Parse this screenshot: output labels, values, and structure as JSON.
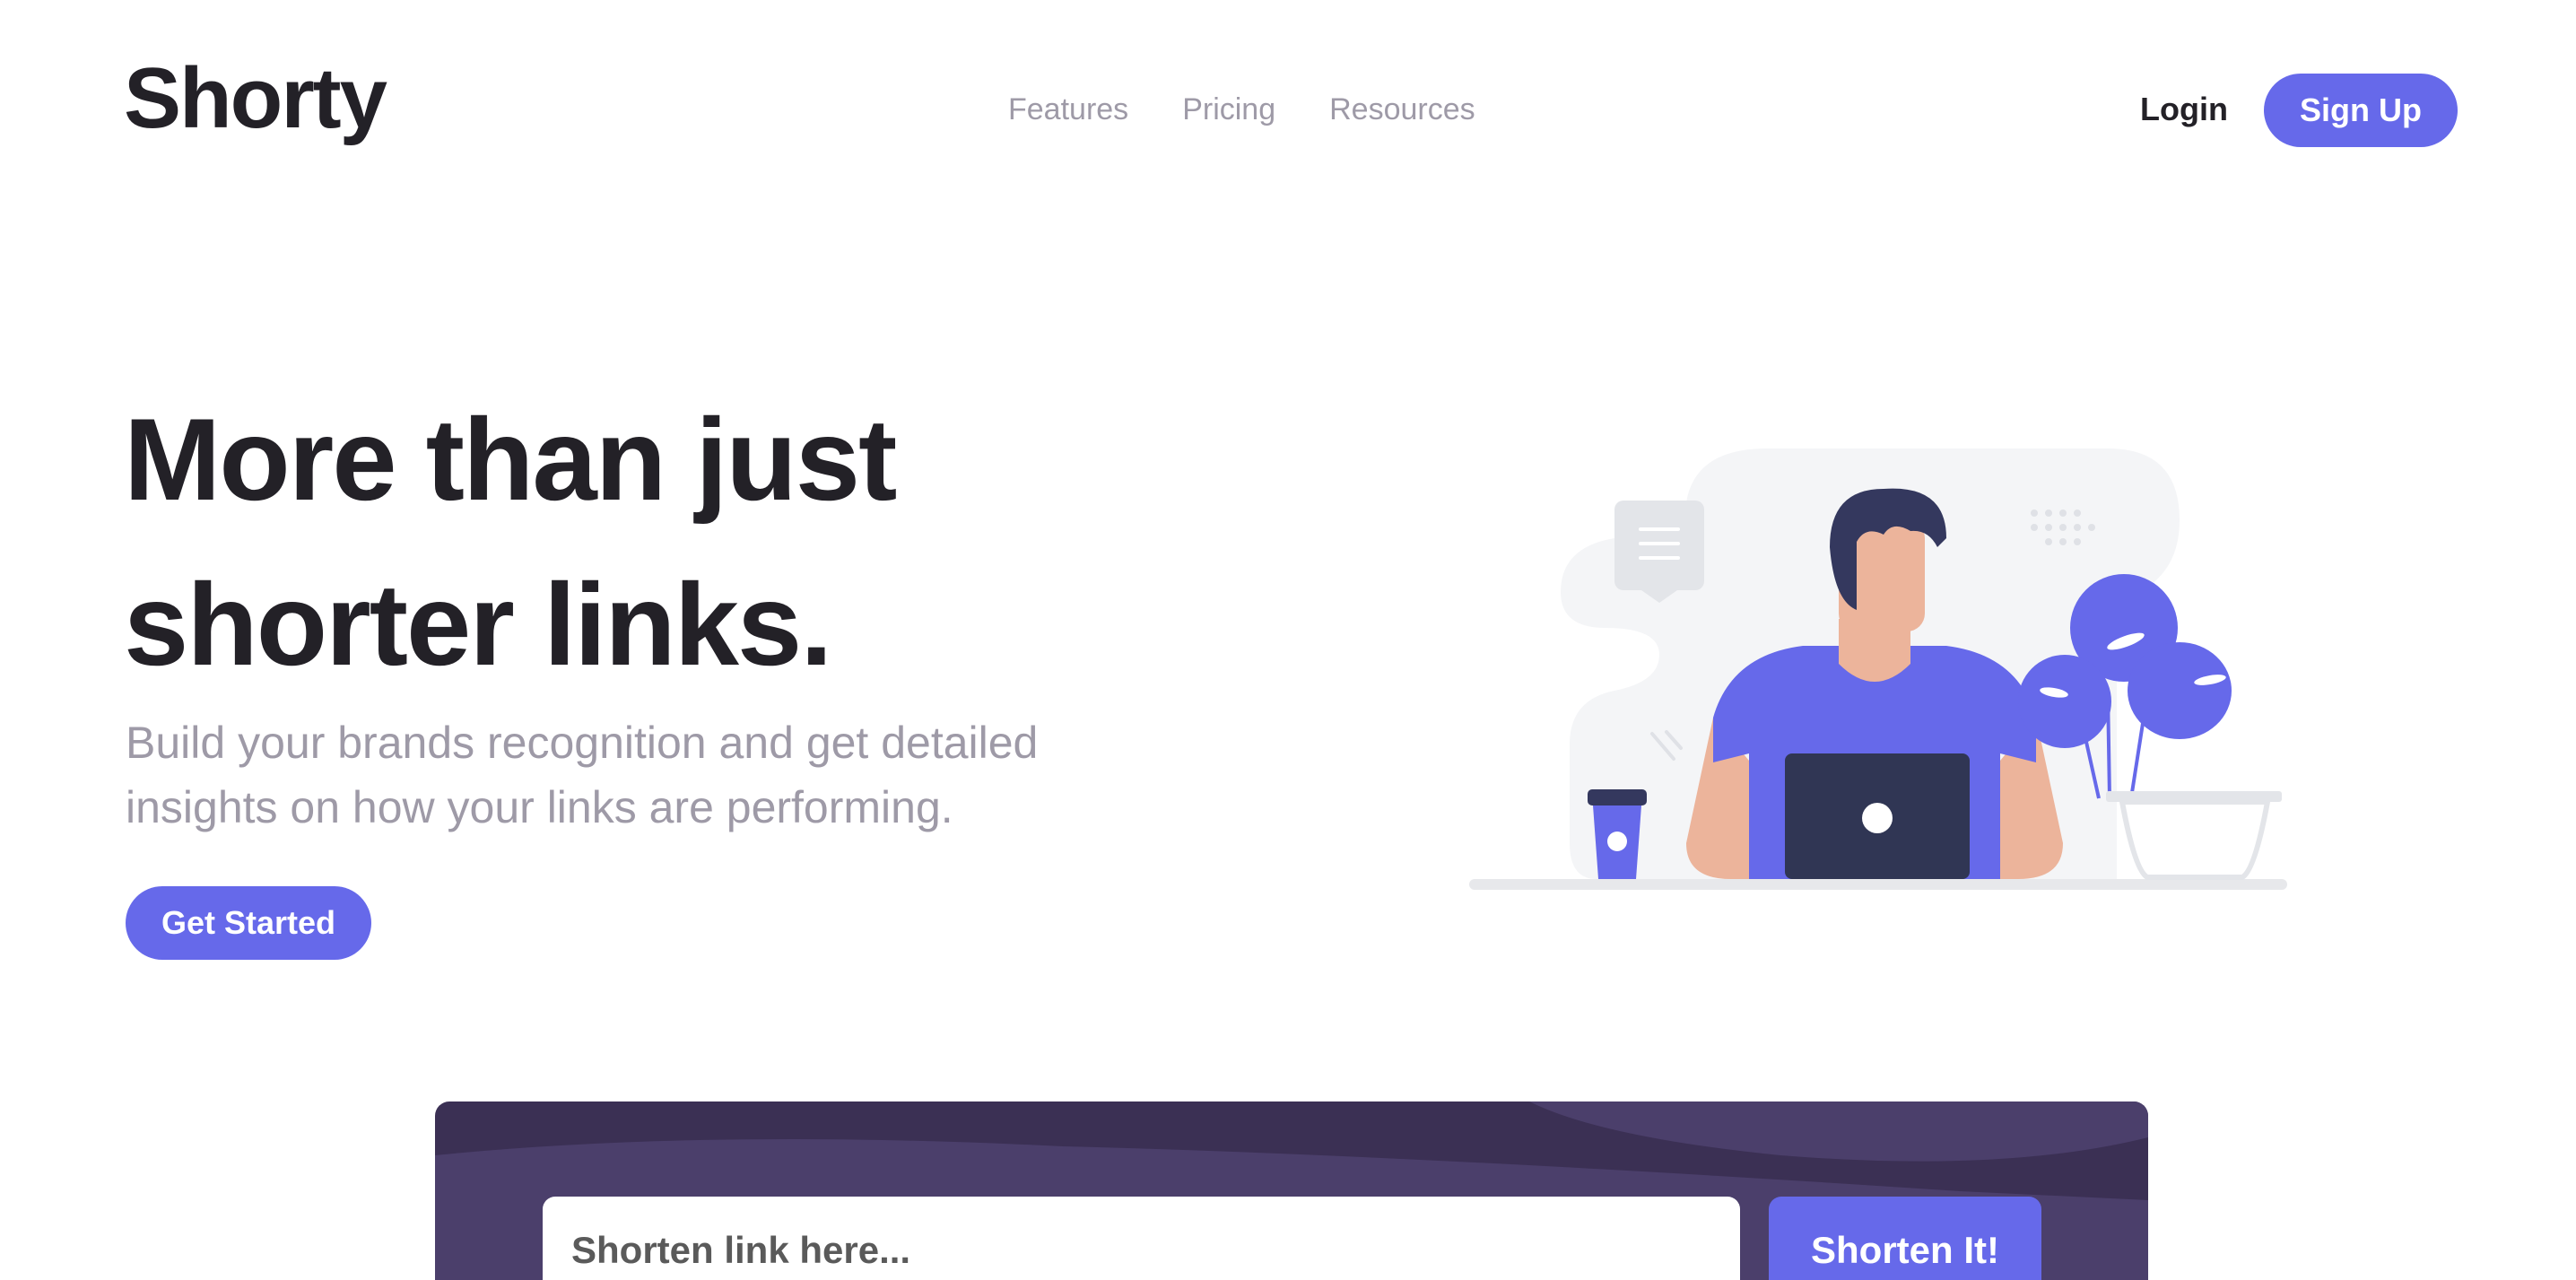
{
  "brand": {
    "logo": "Shorty",
    "accent": "#6669ea",
    "dark": "#232127",
    "muted": "#9e9aa7",
    "panel": "#3b3054"
  },
  "nav": {
    "items": [
      "Features",
      "Pricing",
      "Resources"
    ]
  },
  "auth": {
    "login": "Login",
    "signup": "Sign Up"
  },
  "hero": {
    "headline_line1": "More than just",
    "headline_line2": "shorter links.",
    "subtitle_line1": "Build your brands recognition and get detailed",
    "subtitle_line2": "insights on how your links are performing.",
    "cta": "Get Started",
    "illustration_icon": "person-working-illustration"
  },
  "shorten": {
    "placeholder": "Shorten link here...",
    "button": "Shorten It!"
  }
}
